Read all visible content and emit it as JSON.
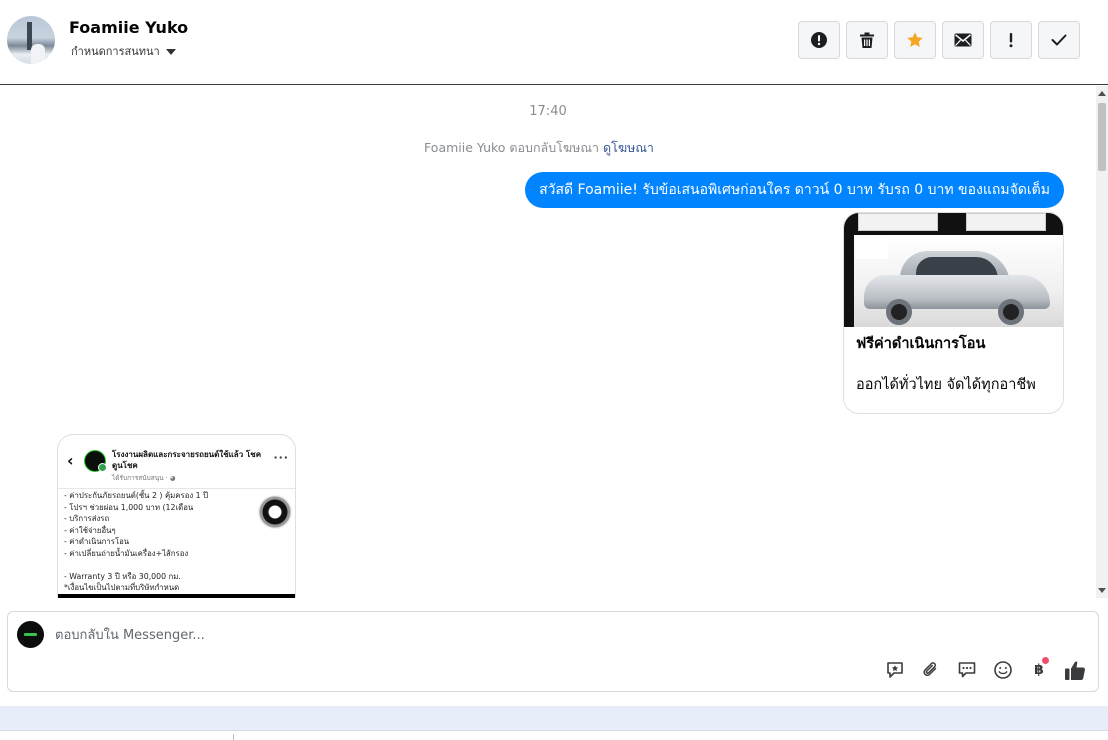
{
  "contact": {
    "name": "Foamiie Yuko",
    "subtitle": "กำหนดการสนทนา"
  },
  "actions": [
    {
      "name": "spam-report",
      "icon": "exclamation-circle-icon"
    },
    {
      "name": "delete",
      "icon": "trash-icon"
    },
    {
      "name": "star",
      "icon": "star-icon",
      "color": "#f5a623"
    },
    {
      "name": "mark-unread",
      "icon": "envelope-icon"
    },
    {
      "name": "follow-up",
      "icon": "exclamation-icon"
    },
    {
      "name": "mark-done",
      "icon": "check-icon"
    }
  ],
  "conversation": {
    "timestamp": "17:40",
    "ad_note_prefix": "Foamiie Yuko ตอบกลับโฆษณา",
    "ad_note_link": "ดูโฆษณา",
    "outgoing_message": "สวัสดี Foamiie! รับข้อเสนอพิเศษก่อนใคร ดาวน์ 0 บาท รับรถ 0 บาท ของแถมจัดเต็ม",
    "ad_card": {
      "title": "ฟรีค่าดำเนินการโอน",
      "description": "ออกได้ทั่วไทย จัดได้ทุกอาชีพ"
    },
    "shared_post": {
      "page_title": "โรงงานผลิตและกระจายรถยนต์ใช้แล้ว โชค ดูนโชค",
      "page_subtitle": "ได้รับการสนับสนุน · ◕",
      "items": [
        "- ค่าประกันภัยรถยนต์(ชั้น 2 ) คุ้มครอง 1 ปี",
        "- โปรฯ ช่วยผ่อน 1,000 บาท (12เดือน",
        "- บริการส่งรถ",
        "- ค่าใช้จ่ายอื่นๆ",
        "- ค่าดำเนินการโอน",
        "- ค่าเปลี่ยนถ่ายน้ำมันเครื่อง+ไส้กรอง",
        "",
        "- Warranty 3 ปี หรือ 30,000 กม.",
        "*เงื่อนไขเป็นไปตามที่บริษัทกำหนด"
      ]
    }
  },
  "composer": {
    "placeholder": "ตอบกลับใน Messenger...",
    "tools": [
      "saved-reply-icon",
      "attachment-icon",
      "chat-bubble-icon",
      "emoji-icon",
      "baht-payment-icon",
      "thumbs-up-icon"
    ],
    "baht_symbol": "฿"
  },
  "colors": {
    "accent": "#0084ff",
    "link": "#385898",
    "star": "#f5a623",
    "notification": "#f0506e"
  }
}
